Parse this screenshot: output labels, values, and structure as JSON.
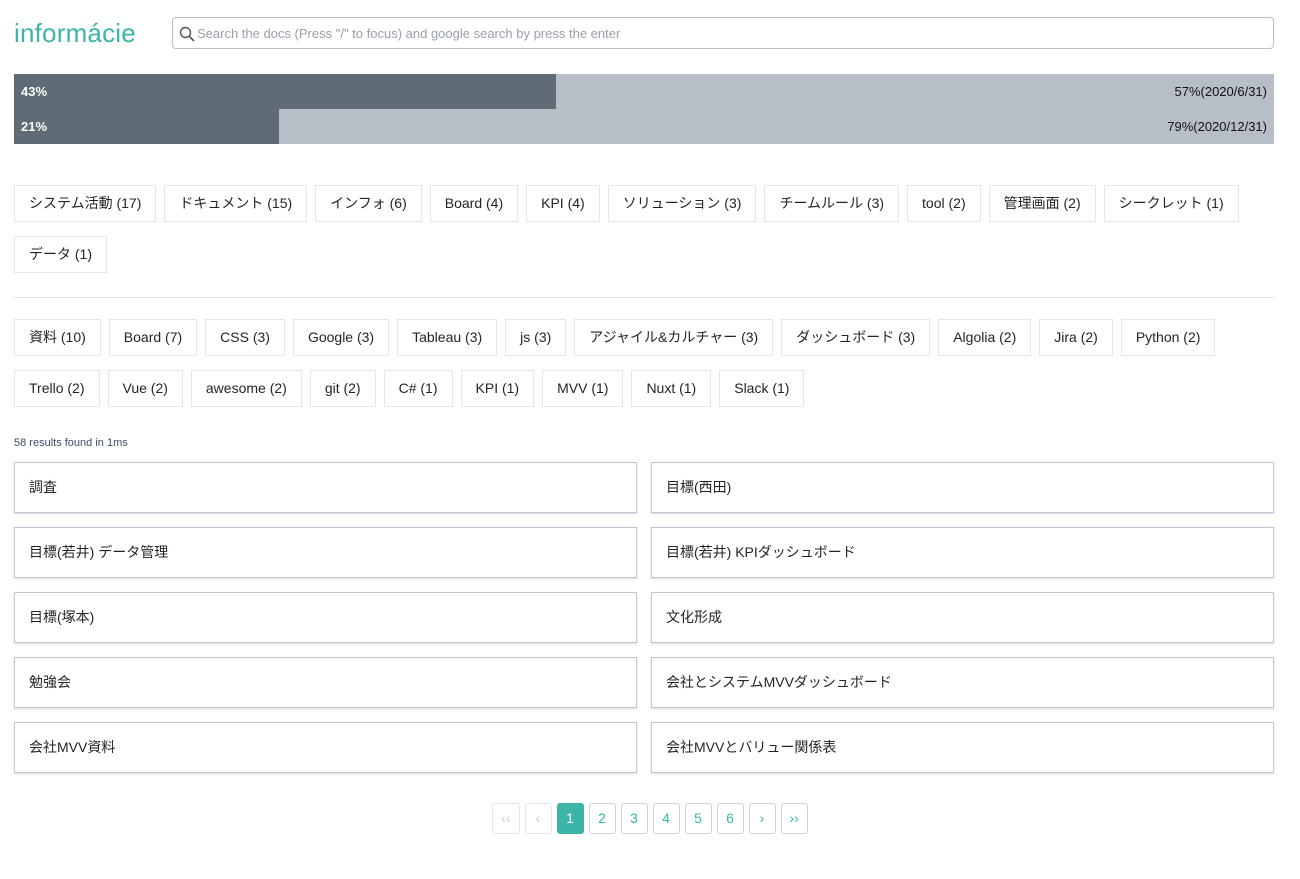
{
  "header": {
    "logo": "informácie",
    "search_placeholder": "Search the docs (Press \"/\" to focus) and google search by press the enter"
  },
  "progress": [
    {
      "done_label": "43%",
      "remaining_label": "57%(2020/6/31)",
      "value": 0.43
    },
    {
      "done_label": "21%",
      "remaining_label": "79%(2020/12/31)",
      "value": 0.21
    }
  ],
  "categories": [
    "システム活動 (17)",
    "ドキュメント (15)",
    "インフォ (6)",
    "Board (4)",
    "KPI (4)",
    "ソリューション (3)",
    "チームルール (3)",
    "tool (2)",
    "管理画面 (2)",
    "シークレット (1)",
    "データ (1)"
  ],
  "tags": [
    "資料 (10)",
    "Board (7)",
    "CSS (3)",
    "Google (3)",
    "Tableau (3)",
    "js (3)",
    "アジャイル&カルチャー (3)",
    "ダッシュボード (3)",
    "Algolia (2)",
    "Jira (2)",
    "Python (2)",
    "Trello (2)",
    "Vue (2)",
    "awesome (2)",
    "git (2)",
    "C# (1)",
    "KPI (1)",
    "MVV (1)",
    "Nuxt (1)",
    "Slack (1)"
  ],
  "results": {
    "count_text": "58 results found in 1ms",
    "items": [
      "調査",
      "目標(西田)",
      "目標(若井) データ管理",
      "目標(若井) KPIダッシュボード",
      "目標(塚本)",
      "文化形成",
      "勉強会",
      "会社とシステムMVVダッシュボード",
      "会社MVV資料",
      "会社MVVとバリュー関係表"
    ]
  },
  "pagination": {
    "first": "‹‹",
    "prev": "‹",
    "next": "›",
    "last": "››",
    "pages": [
      "1",
      "2",
      "3",
      "4",
      "5",
      "6"
    ],
    "current": "1"
  },
  "colors": {
    "accent": "#3cb4a8",
    "progress_fill": "#5f6b75",
    "progress_track": "#b8bec8"
  }
}
